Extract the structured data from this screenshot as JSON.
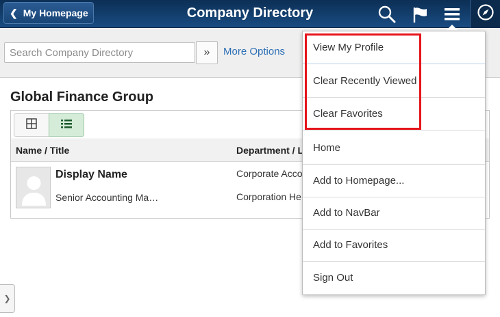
{
  "header": {
    "home_button": "My Homepage",
    "title": "Company Directory",
    "icons": [
      "search-icon",
      "flag-icon",
      "hamburger-menu-icon",
      "navbar-compass-icon"
    ]
  },
  "search": {
    "placeholder": "Search Company Directory",
    "go_label": "»",
    "more_options": "More Options"
  },
  "main": {
    "group_title": "Global Finance Group",
    "columns": [
      "Name / Title",
      "Department / L"
    ],
    "row": {
      "display_name": "Display Name",
      "title": "Senior Accounting Ma…",
      "department": "Corporate Acco",
      "location": "Corporation He"
    }
  },
  "menu": {
    "items": [
      "View My Profile",
      "Clear Recently Viewed",
      "Clear Favorites",
      "Home",
      "Add to Homepage...",
      "Add to NavBar",
      "Add to Favorites",
      "Sign Out"
    ]
  },
  "colors": {
    "header_bg": "#194c82",
    "link": "#2d6fb5",
    "highlight": "#e5141b",
    "active_view": "#d5ecd9"
  }
}
